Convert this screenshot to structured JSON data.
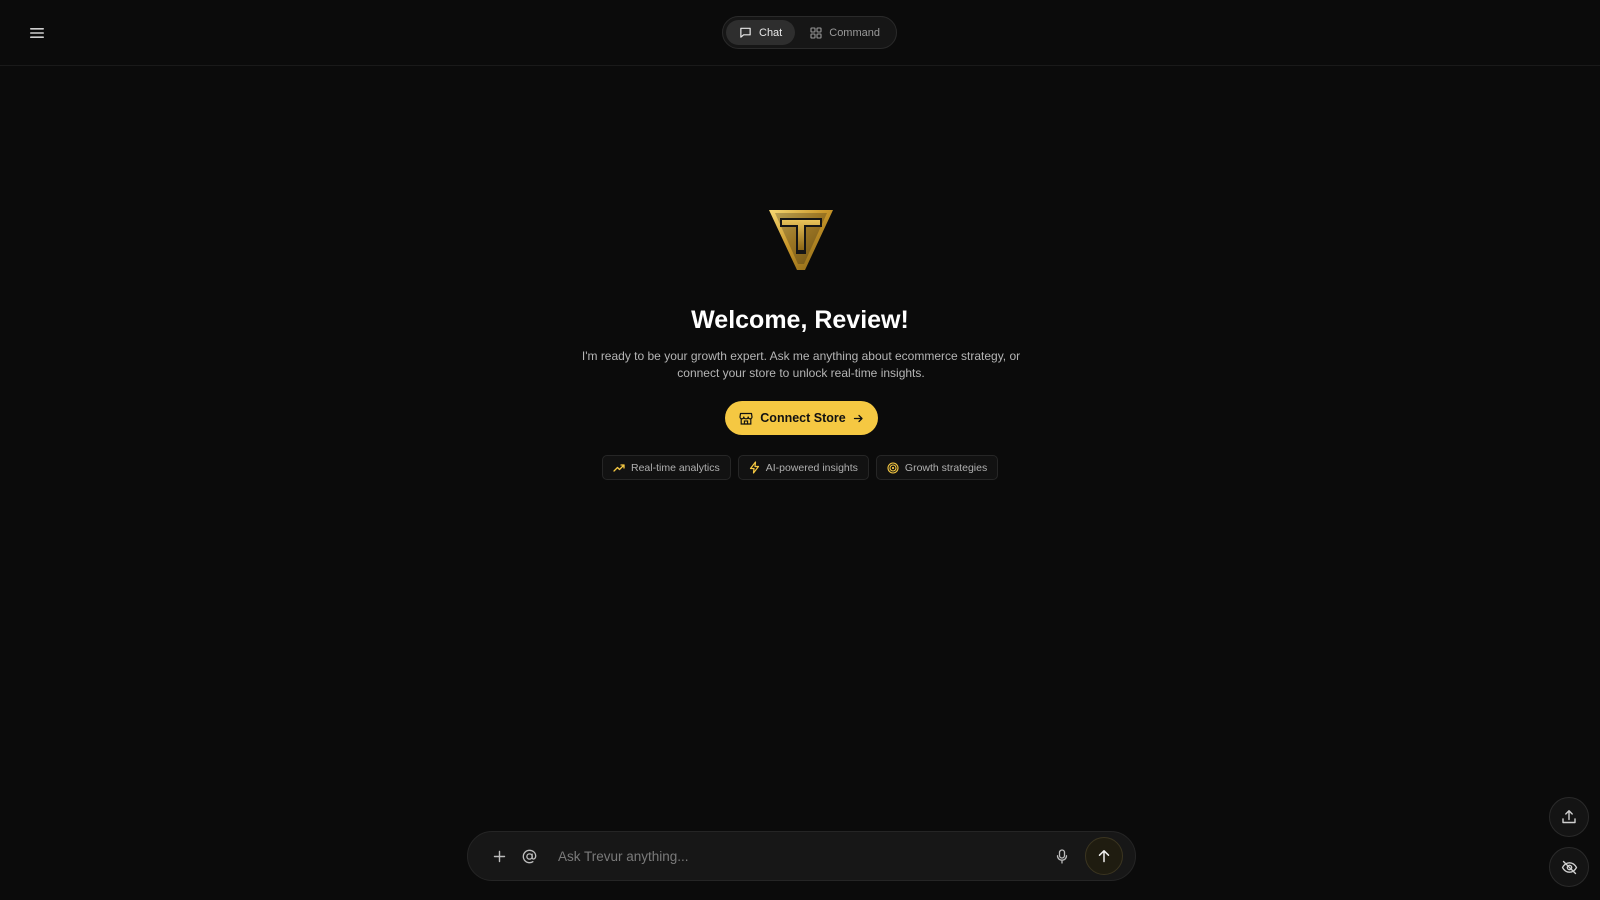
{
  "header": {
    "menu_icon": "menu-icon",
    "tabs": [
      {
        "label": "Chat",
        "icon": "chat-bubble-icon",
        "active": true
      },
      {
        "label": "Command",
        "icon": "grid-icon",
        "active": false
      }
    ]
  },
  "hero": {
    "logo": "trevur-shield-logo",
    "title": "Welcome, Review!",
    "subtitle": "I'm ready to be your growth expert. Ask me anything about ecommerce strategy, or connect your store to unlock real-time insights.",
    "connect_label": "Connect Store",
    "features": [
      {
        "label": "Real-time analytics",
        "icon": "trending-up-icon"
      },
      {
        "label": "AI-powered insights",
        "icon": "lightning-icon"
      },
      {
        "label": "Growth strategies",
        "icon": "target-icon"
      }
    ]
  },
  "composer": {
    "placeholder": "Ask Trevur anything...",
    "value": ""
  },
  "colors": {
    "background": "#0b0b0b",
    "accent": "#f5c842",
    "gold_dark": "#8a6a14"
  }
}
